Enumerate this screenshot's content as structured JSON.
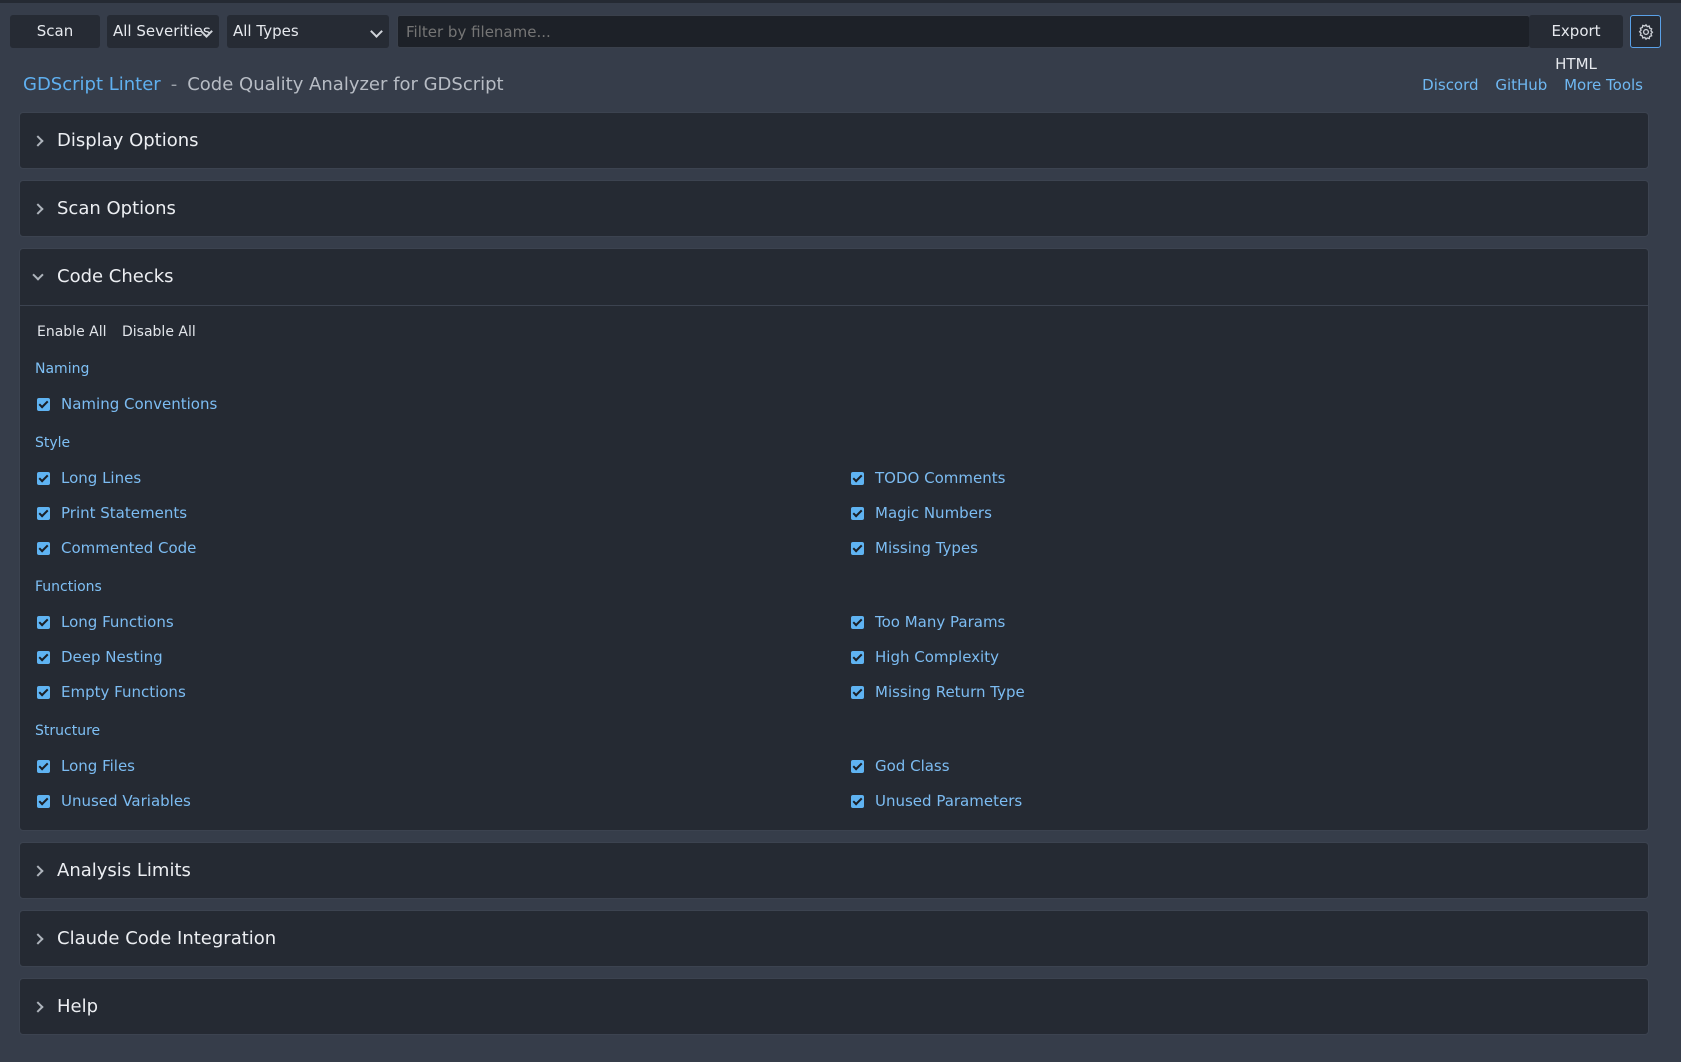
{
  "toolbar": {
    "scan_label": "Scan",
    "severity_selected": "All Severities",
    "type_selected": "All Types",
    "filter_placeholder": "Filter by filename...",
    "filter_value": "",
    "export_label": "Export HTML",
    "settings_icon": "gear-icon"
  },
  "header": {
    "brand": "GDScript Linter",
    "separator": "-",
    "subtitle": "Code Quality Analyzer for GDScript",
    "links": [
      "Discord",
      "GitHub",
      "More Tools"
    ]
  },
  "sections": {
    "display": "Display Options",
    "scan": "Scan Options",
    "checks": "Code Checks",
    "limits": "Analysis Limits",
    "claude": "Claude Code Integration",
    "help": "Help"
  },
  "code_checks": {
    "enable_all": "Enable All",
    "disable_all": "Disable All",
    "naming": {
      "label": "Naming",
      "items": [
        {
          "label": "Naming Conventions",
          "checked": true
        }
      ]
    },
    "style": {
      "label": "Style",
      "items": [
        {
          "label": "Long Lines",
          "checked": true
        },
        {
          "label": "TODO Comments",
          "checked": true
        },
        {
          "label": "Print Statements",
          "checked": true
        },
        {
          "label": "Magic Numbers",
          "checked": true
        },
        {
          "label": "Commented Code",
          "checked": true
        },
        {
          "label": "Missing Types",
          "checked": true
        }
      ]
    },
    "functions": {
      "label": "Functions",
      "items": [
        {
          "label": "Long Functions",
          "checked": true
        },
        {
          "label": "Too Many Params",
          "checked": true
        },
        {
          "label": "Deep Nesting",
          "checked": true
        },
        {
          "label": "High Complexity",
          "checked": true
        },
        {
          "label": "Empty Functions",
          "checked": true
        },
        {
          "label": "Missing Return Type",
          "checked": true
        }
      ]
    },
    "structure": {
      "label": "Structure",
      "items": [
        {
          "label": "Long Files",
          "checked": true
        },
        {
          "label": "God Class",
          "checked": true
        },
        {
          "label": "Unused Variables",
          "checked": true
        },
        {
          "label": "Unused Parameters",
          "checked": true
        }
      ]
    }
  }
}
